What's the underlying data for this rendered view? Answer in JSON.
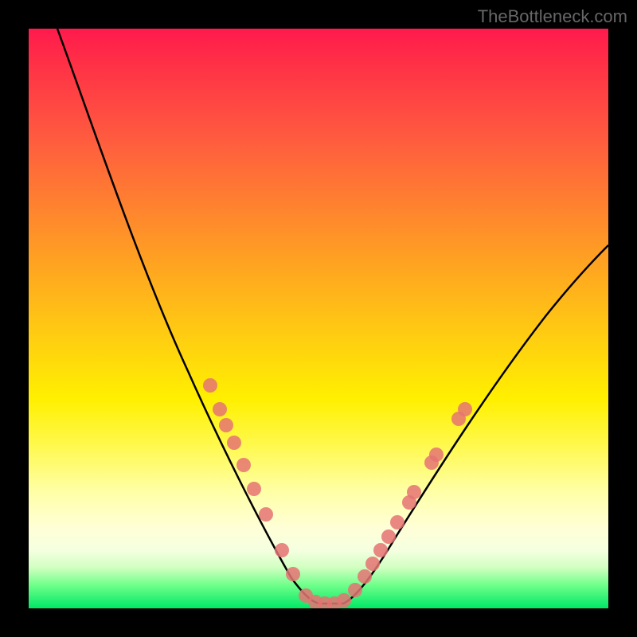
{
  "watermark": "TheBottleneck.com",
  "chart_data": {
    "type": "line",
    "title": "",
    "xlabel": "",
    "ylabel": "",
    "xlim": [
      0,
      100
    ],
    "ylim": [
      0,
      100
    ],
    "curve": {
      "description": "V-shaped bottleneck curve",
      "x": [
        5,
        10,
        15,
        20,
        25,
        30,
        35,
        40,
        45,
        48,
        50,
        52,
        55,
        60,
        65,
        70,
        75,
        80,
        85,
        90,
        95,
        100
      ],
      "y": [
        100,
        90,
        78,
        66,
        55,
        43,
        32,
        21,
        10,
        4,
        1,
        1,
        4,
        12,
        20,
        28,
        35,
        42,
        48,
        53,
        58,
        62
      ]
    },
    "markers": {
      "description": "Pink circular data points along the curve",
      "x": [
        31,
        33,
        35,
        37,
        39,
        41,
        43,
        47,
        48,
        50,
        52,
        53,
        54,
        56,
        57,
        58,
        60,
        61,
        63
      ],
      "y": [
        41,
        37,
        32,
        28,
        23,
        19,
        14,
        6,
        4,
        1,
        1,
        3,
        5,
        9,
        12,
        15,
        20,
        23,
        28
      ]
    },
    "gradient_bands": {
      "description": "Background vertical gradient from red (top) through orange/yellow to green (bottom)",
      "colors": [
        "#ff1a4d",
        "#ff5840",
        "#ffa81f",
        "#fff000",
        "#ffffd6",
        "#00e866"
      ]
    }
  }
}
